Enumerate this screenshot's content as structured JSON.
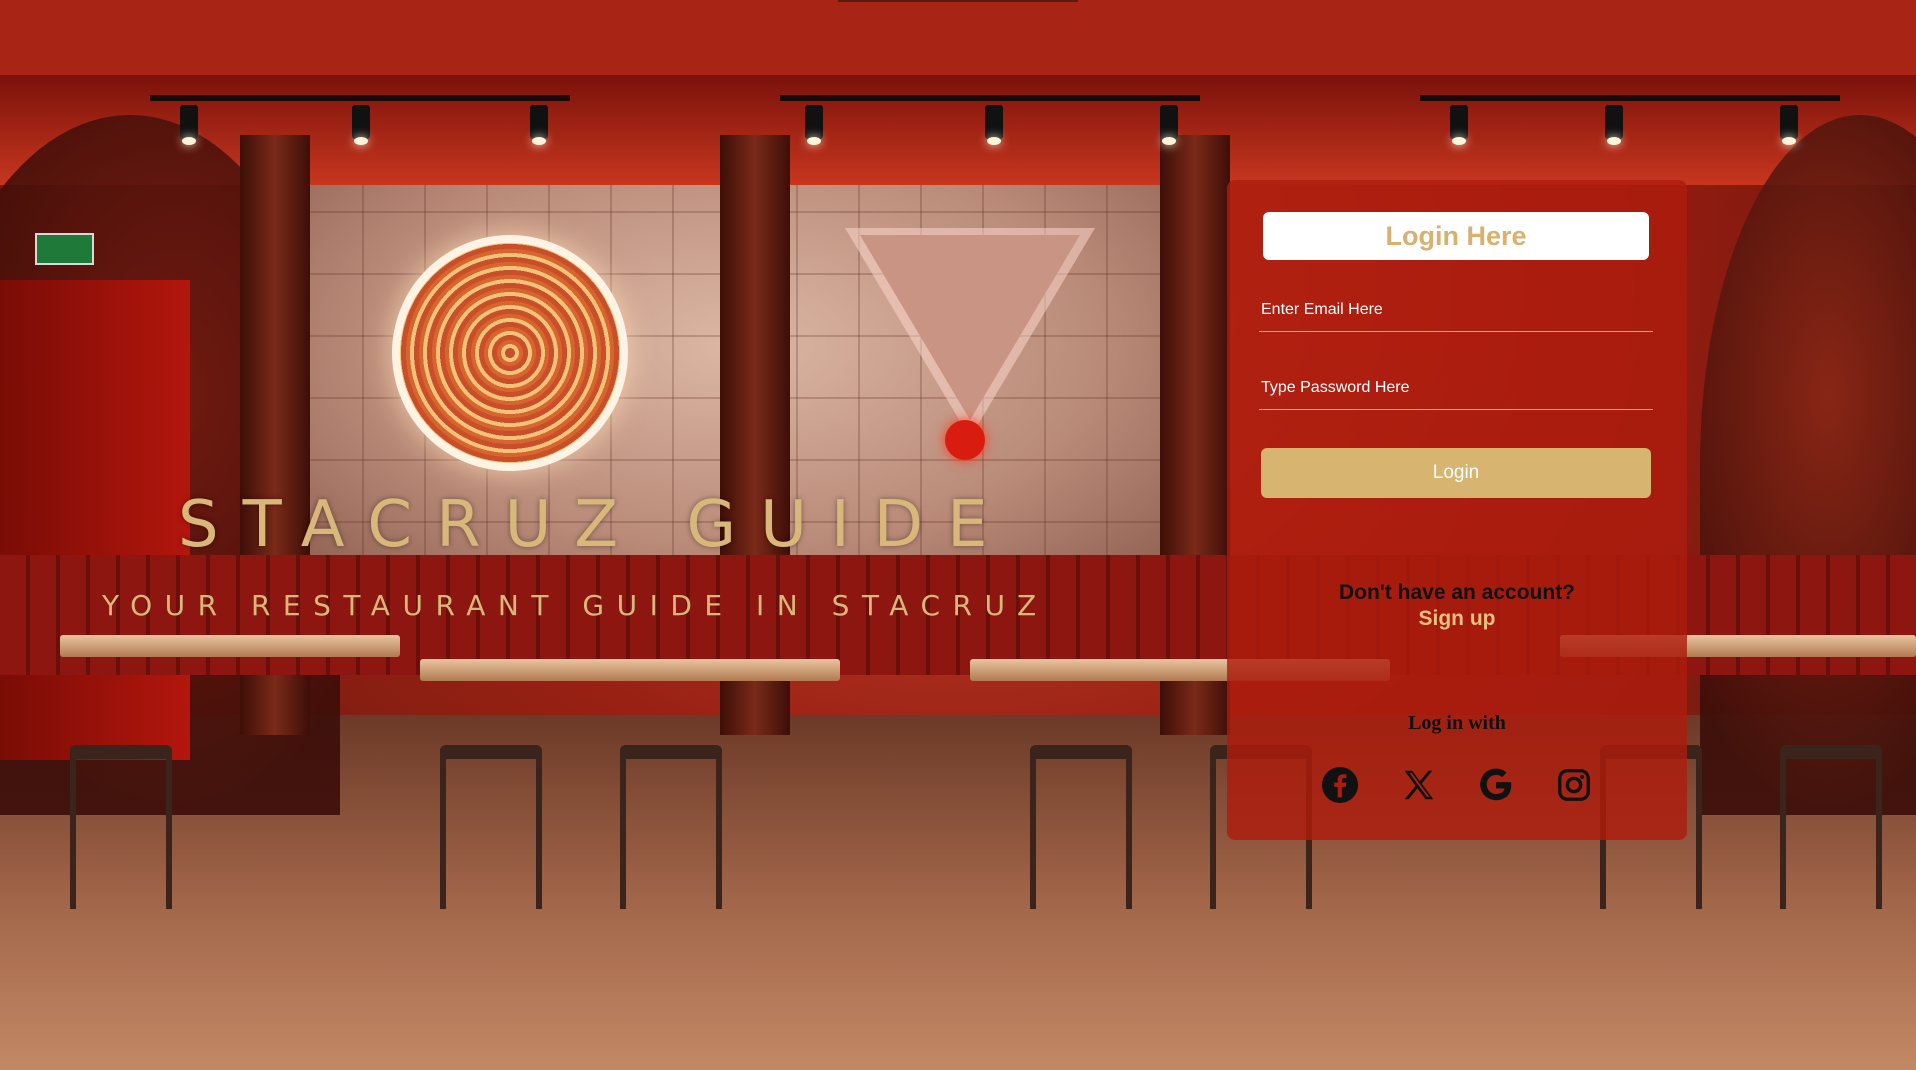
{
  "brand": {
    "title": "STACRUZ GUIDE",
    "subtitle": "YOUR RESTAURANT GUIDE IN STACRUZ"
  },
  "login": {
    "header": "Login Here",
    "email_placeholder": "Enter Email Here",
    "password_placeholder": "Type Password Here",
    "login_button": "Login",
    "signup_prompt": "Don't have an account?",
    "signup_link": "Sign up",
    "login_with": "Log in with",
    "social": [
      {
        "name": "facebook-icon"
      },
      {
        "name": "x-icon"
      },
      {
        "name": "google-icon"
      },
      {
        "name": "instagram-icon"
      }
    ]
  },
  "colors": {
    "top_bar": "#a82415",
    "card": "#ad1c0e",
    "accent_gold": "#d7b46f",
    "text_dark": "#111111"
  }
}
